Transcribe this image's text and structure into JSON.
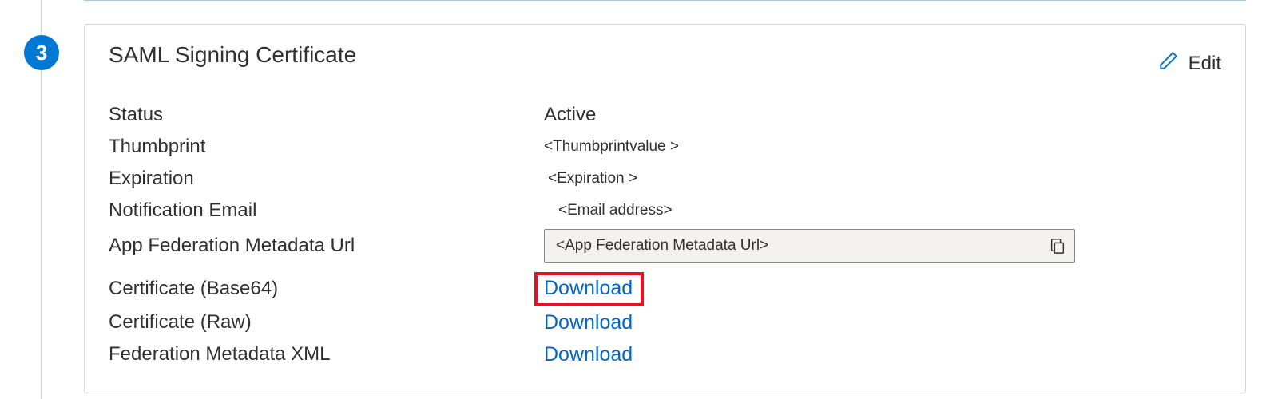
{
  "step": {
    "number": "3"
  },
  "card": {
    "title": "SAML Signing Certificate",
    "edit_label": "Edit"
  },
  "fields": {
    "status": {
      "label": "Status",
      "value": "Active"
    },
    "thumbprint": {
      "label": "Thumbprint",
      "value": "<Thumbprintvalue >"
    },
    "expiration": {
      "label": "Expiration",
      "value": "<Expiration >"
    },
    "notification_email": {
      "label": "Notification Email",
      "value": "<Email address>"
    },
    "metadata_url": {
      "label": "App Federation Metadata Url",
      "value": "<App Federation  Metadata Url>"
    },
    "cert_base64": {
      "label": "Certificate (Base64)",
      "link": "Download"
    },
    "cert_raw": {
      "label": "Certificate (Raw)",
      "link": "Download"
    },
    "fed_metadata_xml": {
      "label": "Federation Metadata XML",
      "link": "Download"
    }
  }
}
